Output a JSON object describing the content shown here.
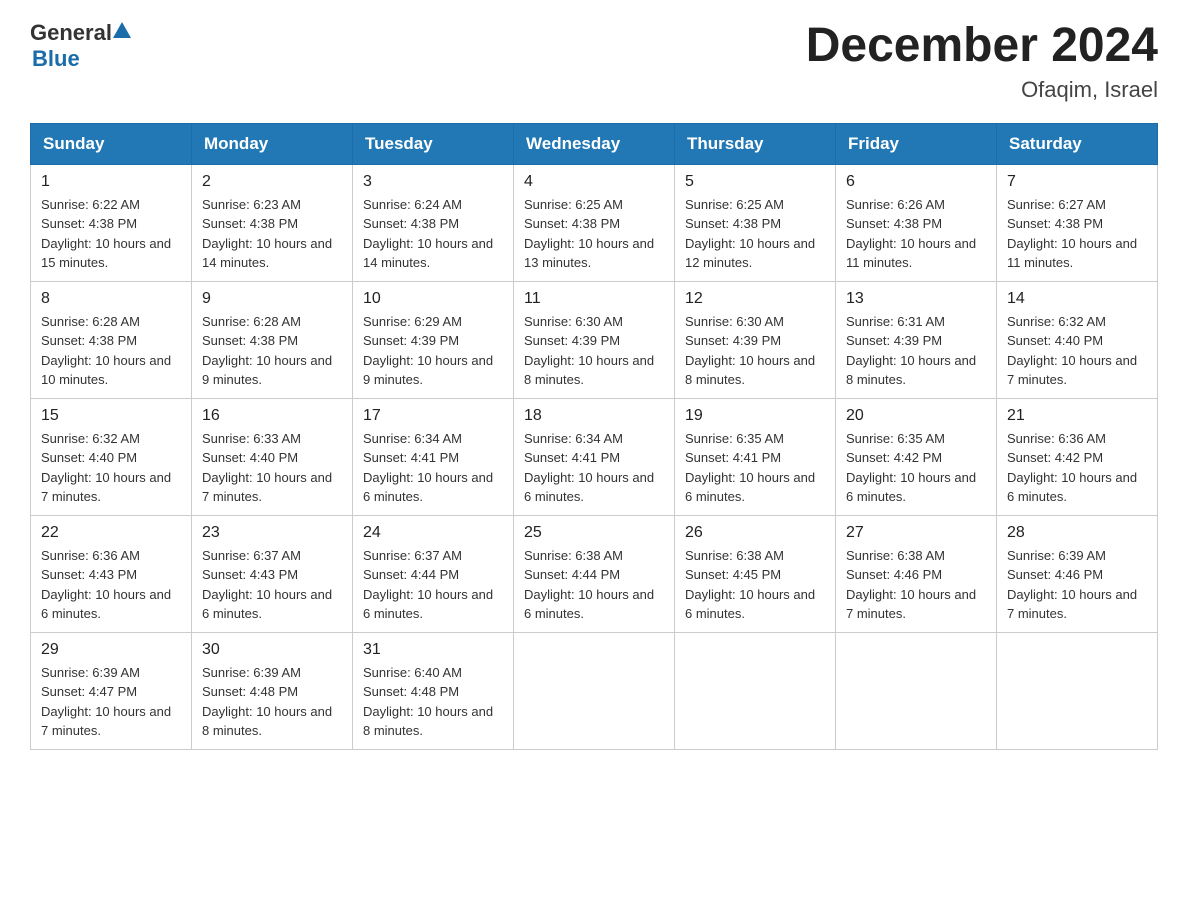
{
  "header": {
    "logo_general": "General",
    "logo_blue": "Blue",
    "month_title": "December 2024",
    "location": "Ofaqim, Israel"
  },
  "weekdays": [
    "Sunday",
    "Monday",
    "Tuesday",
    "Wednesday",
    "Thursday",
    "Friday",
    "Saturday"
  ],
  "weeks": [
    [
      {
        "day": "1",
        "sunrise": "Sunrise: 6:22 AM",
        "sunset": "Sunset: 4:38 PM",
        "daylight": "Daylight: 10 hours and 15 minutes."
      },
      {
        "day": "2",
        "sunrise": "Sunrise: 6:23 AM",
        "sunset": "Sunset: 4:38 PM",
        "daylight": "Daylight: 10 hours and 14 minutes."
      },
      {
        "day": "3",
        "sunrise": "Sunrise: 6:24 AM",
        "sunset": "Sunset: 4:38 PM",
        "daylight": "Daylight: 10 hours and 14 minutes."
      },
      {
        "day": "4",
        "sunrise": "Sunrise: 6:25 AM",
        "sunset": "Sunset: 4:38 PM",
        "daylight": "Daylight: 10 hours and 13 minutes."
      },
      {
        "day": "5",
        "sunrise": "Sunrise: 6:25 AM",
        "sunset": "Sunset: 4:38 PM",
        "daylight": "Daylight: 10 hours and 12 minutes."
      },
      {
        "day": "6",
        "sunrise": "Sunrise: 6:26 AM",
        "sunset": "Sunset: 4:38 PM",
        "daylight": "Daylight: 10 hours and 11 minutes."
      },
      {
        "day": "7",
        "sunrise": "Sunrise: 6:27 AM",
        "sunset": "Sunset: 4:38 PM",
        "daylight": "Daylight: 10 hours and 11 minutes."
      }
    ],
    [
      {
        "day": "8",
        "sunrise": "Sunrise: 6:28 AM",
        "sunset": "Sunset: 4:38 PM",
        "daylight": "Daylight: 10 hours and 10 minutes."
      },
      {
        "day": "9",
        "sunrise": "Sunrise: 6:28 AM",
        "sunset": "Sunset: 4:38 PM",
        "daylight": "Daylight: 10 hours and 9 minutes."
      },
      {
        "day": "10",
        "sunrise": "Sunrise: 6:29 AM",
        "sunset": "Sunset: 4:39 PM",
        "daylight": "Daylight: 10 hours and 9 minutes."
      },
      {
        "day": "11",
        "sunrise": "Sunrise: 6:30 AM",
        "sunset": "Sunset: 4:39 PM",
        "daylight": "Daylight: 10 hours and 8 minutes."
      },
      {
        "day": "12",
        "sunrise": "Sunrise: 6:30 AM",
        "sunset": "Sunset: 4:39 PM",
        "daylight": "Daylight: 10 hours and 8 minutes."
      },
      {
        "day": "13",
        "sunrise": "Sunrise: 6:31 AM",
        "sunset": "Sunset: 4:39 PM",
        "daylight": "Daylight: 10 hours and 8 minutes."
      },
      {
        "day": "14",
        "sunrise": "Sunrise: 6:32 AM",
        "sunset": "Sunset: 4:40 PM",
        "daylight": "Daylight: 10 hours and 7 minutes."
      }
    ],
    [
      {
        "day": "15",
        "sunrise": "Sunrise: 6:32 AM",
        "sunset": "Sunset: 4:40 PM",
        "daylight": "Daylight: 10 hours and 7 minutes."
      },
      {
        "day": "16",
        "sunrise": "Sunrise: 6:33 AM",
        "sunset": "Sunset: 4:40 PM",
        "daylight": "Daylight: 10 hours and 7 minutes."
      },
      {
        "day": "17",
        "sunrise": "Sunrise: 6:34 AM",
        "sunset": "Sunset: 4:41 PM",
        "daylight": "Daylight: 10 hours and 6 minutes."
      },
      {
        "day": "18",
        "sunrise": "Sunrise: 6:34 AM",
        "sunset": "Sunset: 4:41 PM",
        "daylight": "Daylight: 10 hours and 6 minutes."
      },
      {
        "day": "19",
        "sunrise": "Sunrise: 6:35 AM",
        "sunset": "Sunset: 4:41 PM",
        "daylight": "Daylight: 10 hours and 6 minutes."
      },
      {
        "day": "20",
        "sunrise": "Sunrise: 6:35 AM",
        "sunset": "Sunset: 4:42 PM",
        "daylight": "Daylight: 10 hours and 6 minutes."
      },
      {
        "day": "21",
        "sunrise": "Sunrise: 6:36 AM",
        "sunset": "Sunset: 4:42 PM",
        "daylight": "Daylight: 10 hours and 6 minutes."
      }
    ],
    [
      {
        "day": "22",
        "sunrise": "Sunrise: 6:36 AM",
        "sunset": "Sunset: 4:43 PM",
        "daylight": "Daylight: 10 hours and 6 minutes."
      },
      {
        "day": "23",
        "sunrise": "Sunrise: 6:37 AM",
        "sunset": "Sunset: 4:43 PM",
        "daylight": "Daylight: 10 hours and 6 minutes."
      },
      {
        "day": "24",
        "sunrise": "Sunrise: 6:37 AM",
        "sunset": "Sunset: 4:44 PM",
        "daylight": "Daylight: 10 hours and 6 minutes."
      },
      {
        "day": "25",
        "sunrise": "Sunrise: 6:38 AM",
        "sunset": "Sunset: 4:44 PM",
        "daylight": "Daylight: 10 hours and 6 minutes."
      },
      {
        "day": "26",
        "sunrise": "Sunrise: 6:38 AM",
        "sunset": "Sunset: 4:45 PM",
        "daylight": "Daylight: 10 hours and 6 minutes."
      },
      {
        "day": "27",
        "sunrise": "Sunrise: 6:38 AM",
        "sunset": "Sunset: 4:46 PM",
        "daylight": "Daylight: 10 hours and 7 minutes."
      },
      {
        "day": "28",
        "sunrise": "Sunrise: 6:39 AM",
        "sunset": "Sunset: 4:46 PM",
        "daylight": "Daylight: 10 hours and 7 minutes."
      }
    ],
    [
      {
        "day": "29",
        "sunrise": "Sunrise: 6:39 AM",
        "sunset": "Sunset: 4:47 PM",
        "daylight": "Daylight: 10 hours and 7 minutes."
      },
      {
        "day": "30",
        "sunrise": "Sunrise: 6:39 AM",
        "sunset": "Sunset: 4:48 PM",
        "daylight": "Daylight: 10 hours and 8 minutes."
      },
      {
        "day": "31",
        "sunrise": "Sunrise: 6:40 AM",
        "sunset": "Sunset: 4:48 PM",
        "daylight": "Daylight: 10 hours and 8 minutes."
      },
      null,
      null,
      null,
      null
    ]
  ]
}
